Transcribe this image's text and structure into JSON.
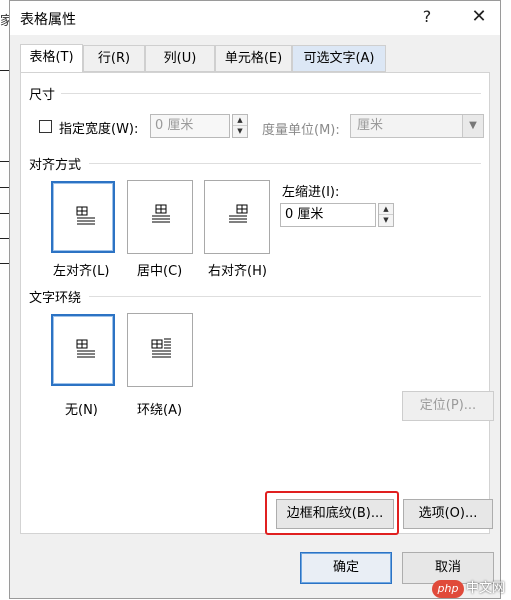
{
  "background": {
    "edge_char": "家"
  },
  "dialog": {
    "title": "表格属性",
    "help_glyph": "?",
    "close_glyph": "✕",
    "tabs": [
      {
        "label": "表格(T)"
      },
      {
        "label": "行(R)"
      },
      {
        "label": "列(U)"
      },
      {
        "label": "单元格(E)"
      },
      {
        "label": "可选文字(A)"
      }
    ],
    "size": {
      "title": "尺寸",
      "specify_width_label": "指定宽度(W):",
      "specify_width_checked": false,
      "width_value": "0 厘米",
      "unit_label": "度量单位(M):",
      "unit_value": "厘米"
    },
    "alignment": {
      "title": "对齐方式",
      "options": [
        {
          "label": "左对齐(L)",
          "selected": true
        },
        {
          "label": "居中(C)",
          "selected": false
        },
        {
          "label": "右对齐(H)",
          "selected": false
        }
      ],
      "indent_label": "左缩进(I):",
      "indent_value": "0 厘米"
    },
    "wrapping": {
      "title": "文字环绕",
      "options": [
        {
          "label": "无(N)",
          "selected": true
        },
        {
          "label": "环绕(A)",
          "selected": false
        }
      ],
      "position_button": "定位(P)..."
    },
    "borders_button": "边框和底纹(B)...",
    "options_button": "选项(O)...",
    "ok_button": "确定",
    "cancel_button": "取消",
    "colors": {
      "accent": "#2c73c4",
      "highlight": "#e02020"
    }
  },
  "watermark": {
    "logo": "php",
    "text": "中文网"
  }
}
